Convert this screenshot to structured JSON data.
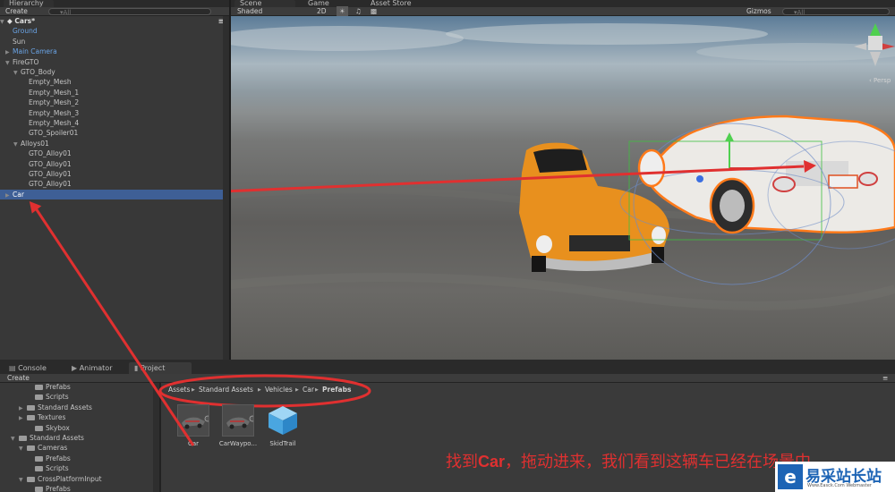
{
  "hierarchy": {
    "tab": "Hierarchy",
    "create": "Create",
    "search": "▾All",
    "scene_name": "Cars*",
    "rows": [
      {
        "label": "Ground",
        "blue": true,
        "indent": 1
      },
      {
        "label": "Sun",
        "indent": 1
      },
      {
        "label": "Main Camera",
        "blue": true,
        "indent": 1,
        "arrow": "▶"
      },
      {
        "label": "FireGTO",
        "indent": 1,
        "arrow": "▼"
      },
      {
        "label": "GTO_Body",
        "indent": 2,
        "arrow": "▼"
      },
      {
        "label": "Empty_Mesh",
        "indent": 3
      },
      {
        "label": "Empty_Mesh_1",
        "indent": 3
      },
      {
        "label": "Empty_Mesh_2",
        "indent": 3
      },
      {
        "label": "Empty_Mesh_3",
        "indent": 3
      },
      {
        "label": "Empty_Mesh_4",
        "indent": 3
      },
      {
        "label": "GTO_Spoiler01",
        "indent": 3
      },
      {
        "label": "Alloys01",
        "indent": 2,
        "arrow": "▼"
      },
      {
        "label": "GTO_Alloy01",
        "indent": 3
      },
      {
        "label": "GTO_Alloy01",
        "indent": 3
      },
      {
        "label": "GTO_Alloy01",
        "indent": 3
      },
      {
        "label": "GTO_Alloy01",
        "indent": 3
      },
      {
        "label": "Car",
        "indent": 1,
        "arrow": "▶",
        "selected": true
      }
    ]
  },
  "scene": {
    "tabs": [
      "Scene",
      "Game",
      "Asset Store"
    ],
    "shaded": "Shaded",
    "mode_2d": "2D",
    "gizmos": "Gizmos",
    "search": "▾All",
    "persp": "‹ Persp"
  },
  "bottom": {
    "tabs": [
      "Console",
      "Animator",
      "Project"
    ],
    "create": "Create"
  },
  "project_tree": [
    {
      "label": "Prefabs",
      "indent": 3
    },
    {
      "label": "Scripts",
      "indent": 3
    },
    {
      "label": "Standard Assets",
      "indent": 2,
      "arrow": "▶"
    },
    {
      "label": "Textures",
      "indent": 2,
      "arrow": "▶"
    },
    {
      "label": "Skybox",
      "indent": 3
    },
    {
      "label": "Standard Assets",
      "indent": 1,
      "arrow": "▼"
    },
    {
      "label": "Cameras",
      "indent": 2,
      "arrow": "▼"
    },
    {
      "label": "Prefabs",
      "indent": 3
    },
    {
      "label": "Scripts",
      "indent": 3
    },
    {
      "label": "CrossPlatformInput",
      "indent": 2,
      "arrow": "▼"
    },
    {
      "label": "Prefabs",
      "indent": 3
    }
  ],
  "breadcrumb": [
    "Assets",
    "Standard Assets",
    "Vehicles",
    "Car",
    "Prefabs"
  ],
  "assets": [
    {
      "label": "Car"
    },
    {
      "label": "CarWaypo..."
    },
    {
      "label": "SkidTrail"
    }
  ],
  "annotation": {
    "text_a": "找到",
    "text_b": "Car",
    "text_c": "，拖动进来，我们看到这辆车已经在场景中",
    "color": "#e03030"
  },
  "watermark": {
    "cn": "易采站长站",
    "en": "Www.Easck.Com Webmaster"
  }
}
